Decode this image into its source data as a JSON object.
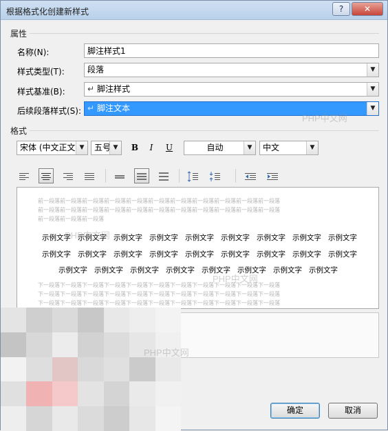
{
  "window": {
    "title": "根据格式化创建新样式",
    "help_label": "?",
    "close_label": "✕"
  },
  "properties": {
    "section_label": "属性",
    "name_label": "名称(N):",
    "name_value": "脚注样式1",
    "style_type_label": "样式类型(T):",
    "style_type_value": "段落",
    "style_based_label": "样式基准(B):",
    "style_based_value": "脚注样式",
    "next_para_label": "后续段落样式(S):",
    "next_para_value": "脚注文本"
  },
  "format": {
    "section_label": "格式",
    "font_value": "宋体 (中文正文)",
    "size_value": "五号",
    "bold_label": "B",
    "italic_label": "I",
    "underline_label": "U",
    "color_value": "自动",
    "language_value": "中文"
  },
  "preview": {
    "prev_para_line1": "前一段落前一段落前一段落前一段落前一段落前一段落前一段落前一段落前一段落前一段落前一段落",
    "prev_para_line2": "前一段落前一段落前一段落前一段落前一段落前一段落前一段落前一段落前一段落前一段落前一段落",
    "prev_para_line3": "前一段落前一段落前一段落",
    "sample_word": "示例文字",
    "next_para_line1": "下一段落下一段落下一段落下一段落下一段落下一段落下一段落下一段落下一段落下一段落下一段落",
    "next_para_line2": "下一段落下一段落下一段落下一段落下一段落下一段落下一段落下一段落下一段落下一段落下一段落",
    "next_para_line3": "下一段落下一段落下一段落下一段落下一段落下一段落下一段落下一段落下一段落下一段落下一段落"
  },
  "buttons": {
    "ok_label": "确定",
    "cancel_label": "取消"
  },
  "watermark": "PHP中文网",
  "icons": {
    "align_left": "align-left-icon",
    "align_center": "align-center-icon",
    "align_right": "align-right-icon",
    "justify": "justify-icon",
    "single_space": "single-spacing-icon",
    "one_half_space": "one-half-spacing-icon",
    "double_space": "double-spacing-icon",
    "increase_para_space": "increase-paragraph-spacing-icon",
    "decrease_para_space": "decrease-paragraph-spacing-icon",
    "decrease_indent": "decrease-indent-icon",
    "increase_indent": "increase-indent-icon"
  }
}
